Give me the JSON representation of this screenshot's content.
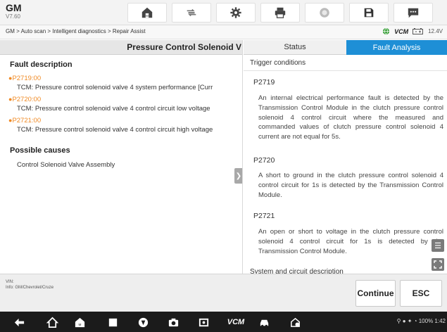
{
  "app": {
    "brand": "GM",
    "version": "V7.60"
  },
  "toolbar": {
    "icons": [
      "home-icon",
      "vehicle-swap-icon",
      "settings-icon",
      "print-icon",
      "help-icon",
      "save-icon",
      "chat-icon"
    ]
  },
  "breadcrumb": "GM > Auto scan > Intelligent diagnostics > Repair Assist",
  "status_bar": {
    "vcm_label": "VCM",
    "voltage": "12.4V"
  },
  "left_panel": {
    "title": "Pressure Control Solenoid V",
    "fault_heading": "Fault description",
    "faults": [
      {
        "code": "P2719:00",
        "desc": "TCM: Pressure control solenoid valve 4 system performance [Curr"
      },
      {
        "code": "P2720:00",
        "desc": "TCM: Pressure control solenoid valve 4 control circuit low voltage"
      },
      {
        "code": "P2721:00",
        "desc": "TCM: Pressure control solenoid valve 4 control circuit high voltage"
      }
    ],
    "causes_heading": "Possible causes",
    "causes": [
      "Control Solenoid Valve Assembly"
    ]
  },
  "right_panel": {
    "tabs": [
      {
        "label": "Status",
        "active": false
      },
      {
        "label": "Fault Analysis",
        "active": true
      }
    ],
    "trigger_heading": "Trigger conditions",
    "entries": [
      {
        "code": "P2719",
        "text": "An internal electrical performance fault is detected by the Transmission Control Module in the clutch pressure control solenoid 4 control circuit where the measured and commanded values of clutch pressure control solenoid 4 current are not equal for 5s."
      },
      {
        "code": "P2720",
        "text": "A short to ground in the clutch pressure control solenoid 4 control circuit for 1s is detected by the Transmission Control Module."
      },
      {
        "code": "P2721",
        "text": "An open or short to voltage in the clutch pressure control solenoid 4 control circuit for 1s is detected by the Transmission Control Module."
      }
    ],
    "system_heading": "System and circuit description"
  },
  "info": {
    "vin_label": "VIN:",
    "info_label": "Info: GM/Chevrolet/Cruze"
  },
  "buttons": {
    "continue": "Continue",
    "esc": "ESC"
  },
  "android": {
    "status_text": "100% 1:42",
    "vcm_label": "VCM"
  },
  "colors": {
    "accent": "#1e8fd6",
    "fault_code": "#f08a24",
    "vcm_green": "#3aa03a"
  }
}
